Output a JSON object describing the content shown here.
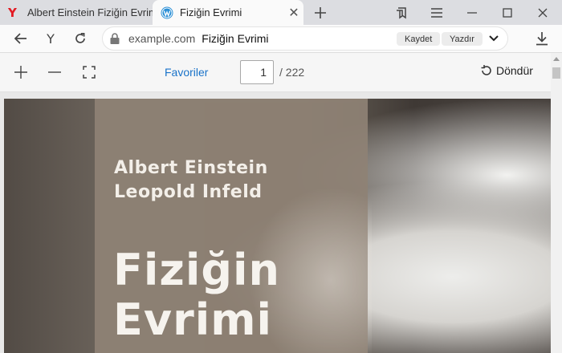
{
  "browser": {
    "tabs": [
      {
        "label": "Albert Einstein Fiziğin Evrim",
        "active": false,
        "icon": "yandex-logo-icon"
      },
      {
        "label": "Fiziğin Evrimi",
        "active": true,
        "icon": "wordpress-logo-icon"
      }
    ],
    "address": {
      "domain": "example.com",
      "title": "Fiziğin Evrimi",
      "save_label": "Kaydet",
      "print_label": "Yazdır"
    }
  },
  "pdf_toolbar": {
    "favorites_label": "Favoriler",
    "current_page": "1",
    "total_pages": "/ 222",
    "rotate_label": "Döndür"
  },
  "cover": {
    "author_1": "Albert Einstein",
    "author_2": "Leopold Infeld",
    "title_line_1": "Fiziğin",
    "title_line_2": "Evrimi"
  },
  "colors": {
    "yandex_red": "#e31b23",
    "wordpress_blue": "#2a8fd6",
    "link_blue": "#1a73c9"
  }
}
